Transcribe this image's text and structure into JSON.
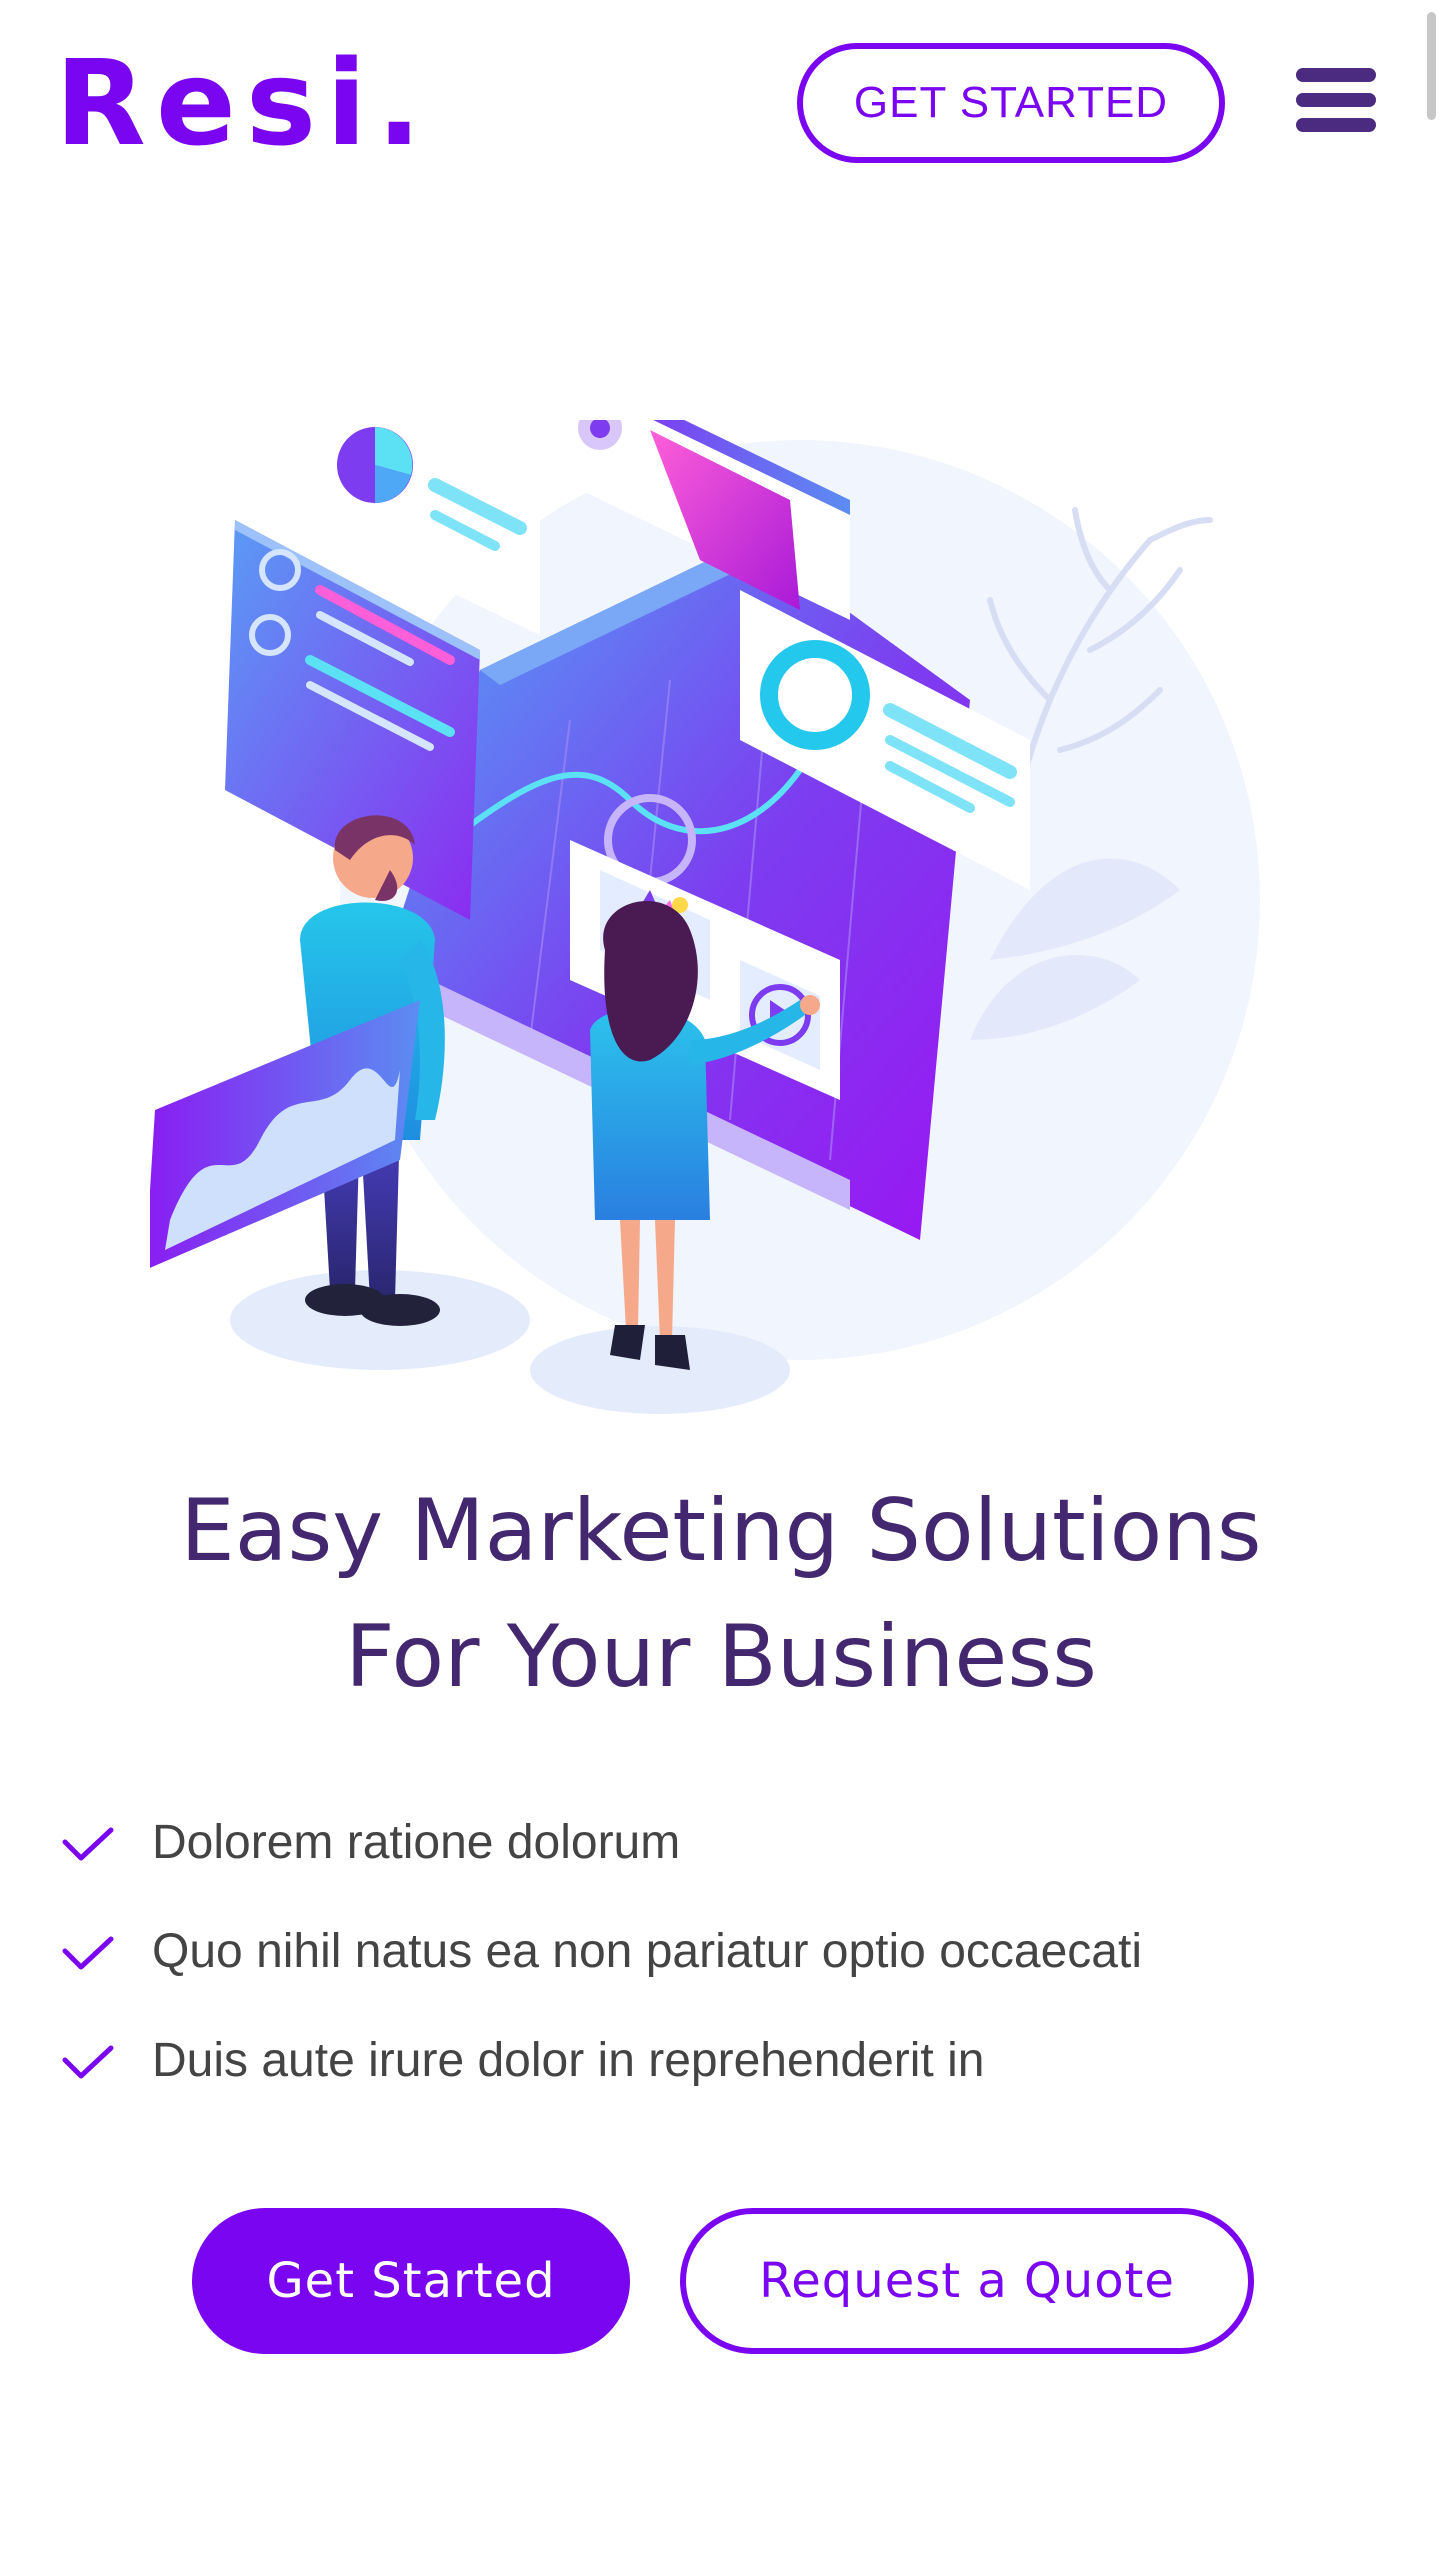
{
  "header": {
    "logo_text": "Resi.",
    "cta_label": "GET STARTED",
    "menu_icon": "hamburger-menu-icon"
  },
  "hero": {
    "illustration": "isometric-marketing-dashboard-illustration",
    "title_line_1": "Easy Marketing Solutions",
    "title_line_2": "For Your Business",
    "features": [
      "Dolorem ratione dolorum",
      "Quo nihil natus ea non pariatur optio occaecati",
      "Duis aute irure dolor in reprehenderit in"
    ],
    "feature_icon": "check-icon",
    "primary_button_label": "Get Started",
    "secondary_button_label": "Request a Quote"
  },
  "colors": {
    "brand": "#7a05f0",
    "heading": "#44286f",
    "body_text": "#444444",
    "menu_icon": "#4b2b7f"
  }
}
